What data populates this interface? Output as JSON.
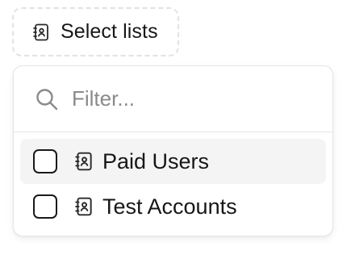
{
  "trigger": {
    "icon": "contact-book-icon",
    "label": "Select lists"
  },
  "filter": {
    "icon": "search-icon",
    "placeholder": "Filter...",
    "value": ""
  },
  "lists": [
    {
      "label": "Paid Users",
      "icon": "contact-book-icon",
      "checked": false,
      "highlighted": true
    },
    {
      "label": "Test Accounts",
      "icon": "contact-book-icon",
      "checked": false,
      "highlighted": false
    }
  ],
  "colors": {
    "text": "#171717",
    "muted": "#8a8a8a",
    "border": "#e5e5e5",
    "highlight": "#f4f4f4"
  }
}
